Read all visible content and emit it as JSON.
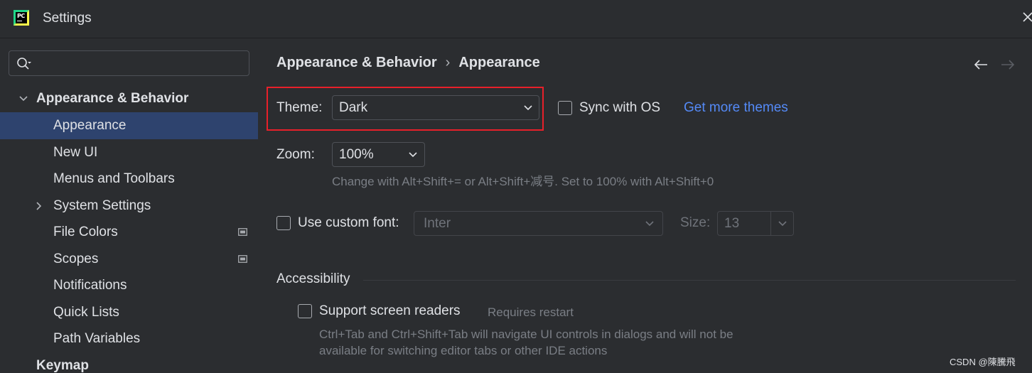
{
  "window": {
    "title": "Settings",
    "logo_text": "PC"
  },
  "sidebar": {
    "search": {
      "value": "",
      "placeholder": ""
    },
    "items": [
      {
        "label": "Appearance & Behavior",
        "expanded": true
      },
      {
        "label": "Appearance",
        "selected": true
      },
      {
        "label": "New UI"
      },
      {
        "label": "Menus and Toolbars"
      },
      {
        "label": "System Settings",
        "collapsed": true
      },
      {
        "label": "File Colors",
        "project_icon": true
      },
      {
        "label": "Scopes",
        "project_icon": true
      },
      {
        "label": "Notifications"
      },
      {
        "label": "Quick Lists"
      },
      {
        "label": "Path Variables"
      },
      {
        "label": "Keymap"
      }
    ]
  },
  "content": {
    "breadcrumb": {
      "parent": "Appearance & Behavior",
      "separator": "›",
      "current": "Appearance"
    },
    "theme": {
      "label": "Theme:",
      "value": "Dark"
    },
    "sync_os": {
      "label": "Sync with OS",
      "checked": false
    },
    "get_more_themes": "Get more themes",
    "zoom": {
      "label": "Zoom:",
      "value": "100%",
      "hint": "Change with Alt+Shift+= or Alt+Shift+减号. Set to 100% with Alt+Shift+0"
    },
    "custom_font": {
      "label": "Use custom font:",
      "checked": false,
      "font_value": "Inter",
      "size_label": "Size:",
      "size_value": "13"
    },
    "accessibility": {
      "heading": "Accessibility",
      "screen_readers": {
        "label": "Support screen readers",
        "checked": false,
        "note": "Requires restart"
      },
      "hint_line1": "Ctrl+Tab and Ctrl+Shift+Tab will navigate UI controls in dialogs and will not be",
      "hint_line2": "available for switching editor tabs or other IDE actions"
    }
  },
  "watermark": "CSDN @陳騰飛",
  "colors": {
    "background": "#2b2d30",
    "selection": "#2e436e",
    "link": "#548af7",
    "highlight": "#e8202a",
    "text": "#dfe1e5",
    "hint": "#7a7e85"
  }
}
